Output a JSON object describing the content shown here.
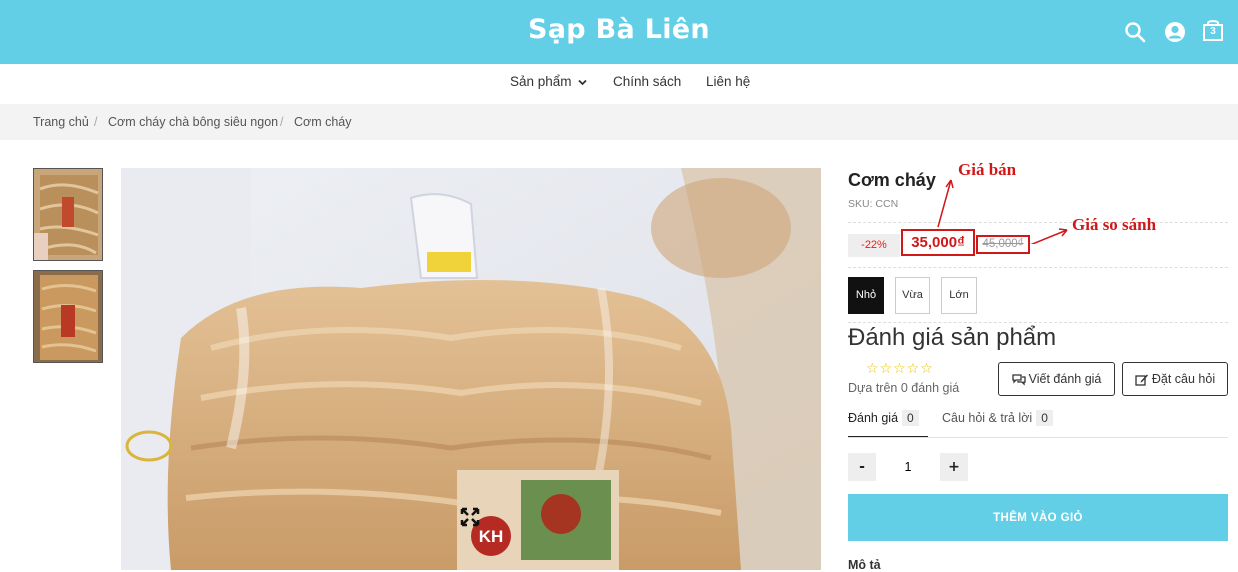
{
  "header": {
    "site_title": "Sạp Bà Liên",
    "cart_count": "3",
    "bg_color": "#62cfe6"
  },
  "nav": {
    "items": [
      {
        "label": "Sản phẩm",
        "has_dropdown": true
      },
      {
        "label": "Chính sách"
      },
      {
        "label": "Liên hệ"
      }
    ]
  },
  "breadcrumb": [
    "Trang chủ",
    "Cơm cháy chà bông siêu ngon",
    "Cơm cháy"
  ],
  "product": {
    "title": "Cơm cháy",
    "sku": "SKU: CCN",
    "discount": "-22%",
    "price": "35,000₫",
    "compare_price": "45,000₫",
    "variants": [
      {
        "label": "Nhỏ",
        "selected": true
      },
      {
        "label": "Vừa",
        "selected": false
      },
      {
        "label": "Lớn",
        "selected": false
      }
    ]
  },
  "annotations": {
    "sale_price": "Giá bán",
    "compare_price": "Giá so sánh",
    "color": "#d01818"
  },
  "reviews": {
    "title": "Đánh giá sản phẩm",
    "stars": "☆☆☆☆☆",
    "rating": 0,
    "based_on": "Dựa trên 0 đánh giá",
    "write_review": "Viết đánh giá",
    "ask_question": "Đặt câu hỏi",
    "tabs": [
      {
        "label": "Đánh giá",
        "count": "0",
        "active": true
      },
      {
        "label": "Câu hỏi & trả lời",
        "count": "0",
        "active": false
      }
    ]
  },
  "quantity": {
    "minus": "-",
    "value": "1",
    "plus": "+"
  },
  "add_to_cart": "THÊM VÀO GIỎ",
  "description_heading": "Mô tả"
}
